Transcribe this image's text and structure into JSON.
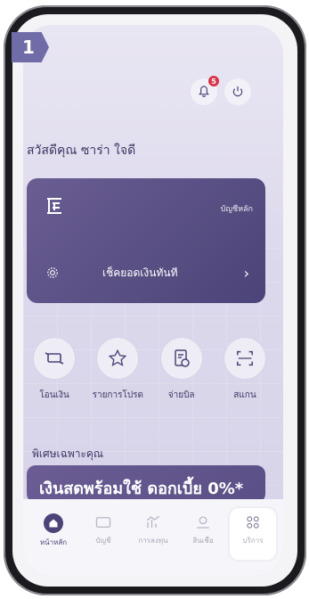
{
  "step_badge": "1",
  "header": {
    "notification_count": "5"
  },
  "greeting": "สวัสดีคุณ ซาร่า ใจดี",
  "account_card": {
    "type_label": "บัญชีหลัก",
    "balance_label": "เช็คยอดเงินทันที"
  },
  "quick_actions": [
    {
      "label": "โอนเงิน",
      "icon": "transfer-icon"
    },
    {
      "label": "รายการโปรด",
      "icon": "star-icon"
    },
    {
      "label": "จ่ายบิล",
      "icon": "bill-icon"
    },
    {
      "label": "สแกน",
      "icon": "scan-icon"
    }
  ],
  "special": {
    "title": "พิเศษเฉพาะคุณ",
    "promo_text": "เงินสดพร้อมใช้ ดอกเบี้ย 0%*"
  },
  "tabs": [
    {
      "label": "หน้าหลัก",
      "icon": "home-icon"
    },
    {
      "label": "บัญชี",
      "icon": "wallet-icon"
    },
    {
      "label": "การลงทุน",
      "icon": "investment-icon"
    },
    {
      "label": "สินเชื่อ",
      "icon": "loan-icon"
    },
    {
      "label": "บริการ",
      "icon": "services-icon"
    }
  ],
  "colors": {
    "brand": "#4b4478",
    "badge": "#6f6ca8",
    "notification": "#d9344b"
  }
}
